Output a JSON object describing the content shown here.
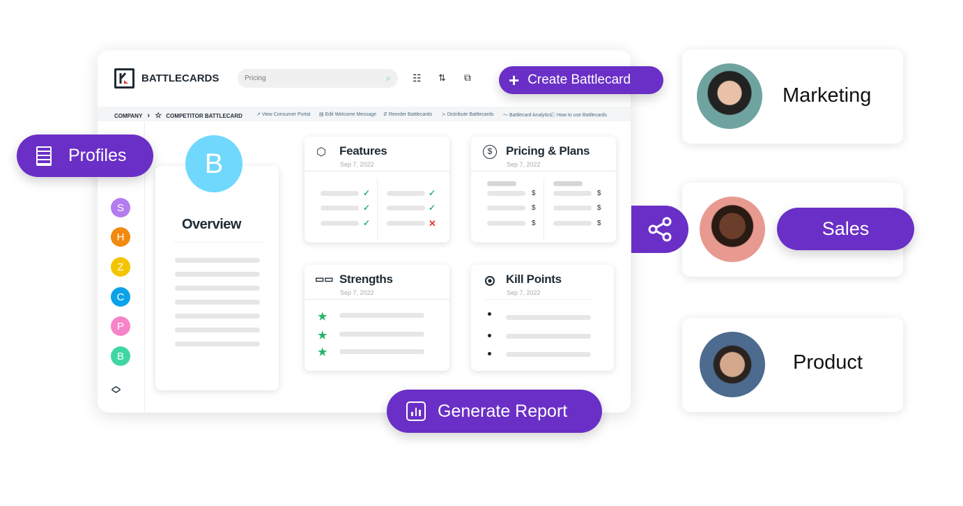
{
  "header": {
    "app_title": "BATTLECARDS",
    "search_value": "Pricing",
    "create_button": "Create Battlecard"
  },
  "breadcrumb": {
    "company": "COMPANY",
    "current": "COMPETITOR BATTLECARD",
    "links": [
      "View Consumer Portal",
      "Edit Welcome Message",
      "Reorder Battlecards",
      "Distribute Battlecards",
      "Battlecard Analytics",
      "How to use Battlecards"
    ]
  },
  "sidebar": {
    "avatars": [
      {
        "letter": "S",
        "color": "#b57cf0"
      },
      {
        "letter": "H",
        "color": "#f28a0f"
      },
      {
        "letter": "Z",
        "color": "#f5c400"
      },
      {
        "letter": "C",
        "color": "#0ba2e8"
      },
      {
        "letter": "P",
        "color": "#f783c8"
      },
      {
        "letter": "B",
        "color": "#3fd6a4"
      }
    ]
  },
  "profiles_button": "Profiles",
  "overview": {
    "letter": "B",
    "title": "Overview",
    "color": "#6fd8fc"
  },
  "cards": {
    "features": {
      "title": "Features",
      "date": "Sep 7, 2022"
    },
    "pricing": {
      "title": "Pricing & Plans",
      "date": "Sep 7, 2022",
      "currency": "$"
    },
    "strengths": {
      "title": "Strengths",
      "date": "Sep 7, 2022"
    },
    "kill_points": {
      "title": "Kill Points",
      "date": "Sep 7, 2022"
    }
  },
  "generate_report": "Generate Report",
  "people": [
    {
      "role": "Marketing"
    },
    {
      "role": "Sales"
    },
    {
      "role": "Product"
    }
  ],
  "colors": {
    "accent": "#6a2fc6"
  }
}
